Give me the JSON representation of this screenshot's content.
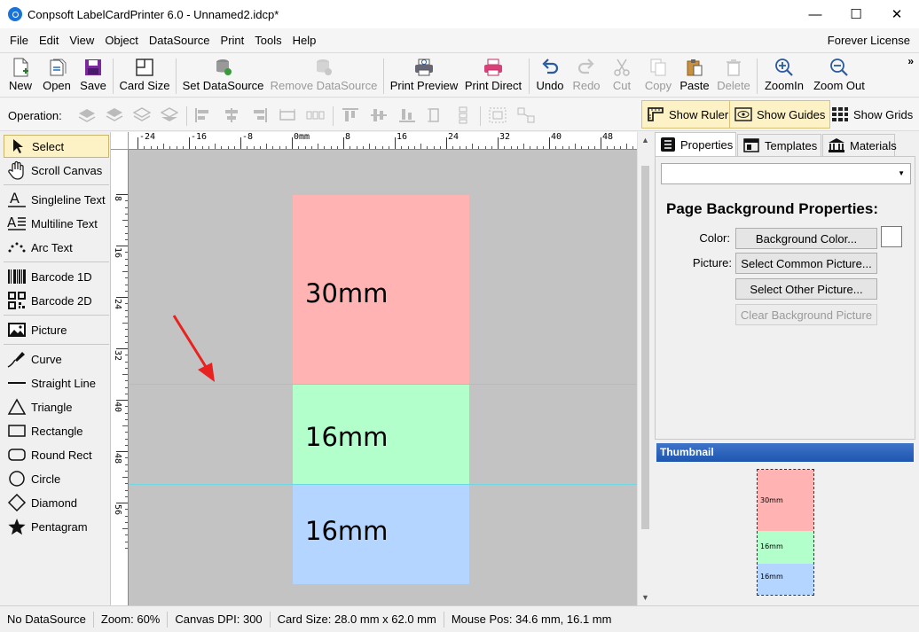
{
  "window": {
    "title": "Conpsoft LabelCardPrinter 6.0 - Unnamed2.idcp*",
    "minimize": "—",
    "maximize": "☐",
    "close": "✕"
  },
  "menu": {
    "items": [
      "File",
      "Edit",
      "View",
      "Object",
      "DataSource",
      "Print",
      "Tools",
      "Help"
    ],
    "license": "Forever License"
  },
  "toolbar": {
    "new": "New",
    "open": "Open",
    "save": "Save",
    "card_size": "Card Size",
    "set_datasource": "Set DataSource",
    "remove_datasource": "Remove DataSource",
    "print_preview": "Print Preview",
    "print_direct": "Print Direct",
    "undo": "Undo",
    "redo": "Redo",
    "cut": "Cut",
    "copy": "Copy",
    "paste": "Paste",
    "delete": "Delete",
    "zoom_in": "ZoomIn",
    "zoom_out": "Zoom Out",
    "more": "»"
  },
  "operation": {
    "label": "Operation:",
    "show_ruler": "Show Ruler",
    "show_guides": "Show Guides",
    "show_grids": "Show Grids"
  },
  "tools": {
    "select": "Select",
    "scroll_canvas": "Scroll Canvas",
    "singleline_text": "Singleline Text",
    "multiline_text": "Multiline Text",
    "arc_text": "Arc Text",
    "barcode_1d": "Barcode 1D",
    "barcode_2d": "Barcode 2D",
    "picture": "Picture",
    "curve": "Curve",
    "straight_line": "Straight Line",
    "triangle": "Triangle",
    "rectangle": "Rectangle",
    "round_rect": "Round Rect",
    "circle": "Circle",
    "diamond": "Diamond",
    "pentagram": "Pentagram"
  },
  "rulers": {
    "horizontal": [
      "-24",
      "-16",
      "-8",
      "0mm",
      "8",
      "16",
      "24",
      "32",
      "40",
      "48"
    ],
    "vertical": [
      "8",
      "16",
      "24",
      "32",
      "40",
      "48",
      "56"
    ]
  },
  "canvas": {
    "sections": [
      {
        "label": "30mm",
        "color": "#ffb3b3"
      },
      {
        "label": "16mm",
        "color": "#b3ffcc"
      },
      {
        "label": "16mm",
        "color": "#b3d5ff"
      }
    ],
    "guide_color": "#6fd8e4",
    "arrow_color": "#e8231f"
  },
  "right_panel": {
    "tabs": [
      "Properties",
      "Templates",
      "Materials"
    ],
    "heading": "Page Background Properties:",
    "color_label": "Color:",
    "picture_label": "Picture:",
    "background_color_button": "Background Color...",
    "select_common_button": "Select Common Picture...",
    "select_other_button": "Select Other Picture...",
    "clear_button": "Clear Background Picture",
    "thumbnail_title": "Thumbnail",
    "thumb_labels": [
      "30mm",
      "16mm",
      "16mm"
    ]
  },
  "status": {
    "datasource": "No DataSource",
    "zoom": "Zoom: 60%",
    "dpi": "Canvas DPI: 300",
    "card_size": "Card Size: 28.0 mm x 62.0 mm",
    "mouse_pos": "Mouse Pos: 34.6 mm, 16.1 mm"
  }
}
